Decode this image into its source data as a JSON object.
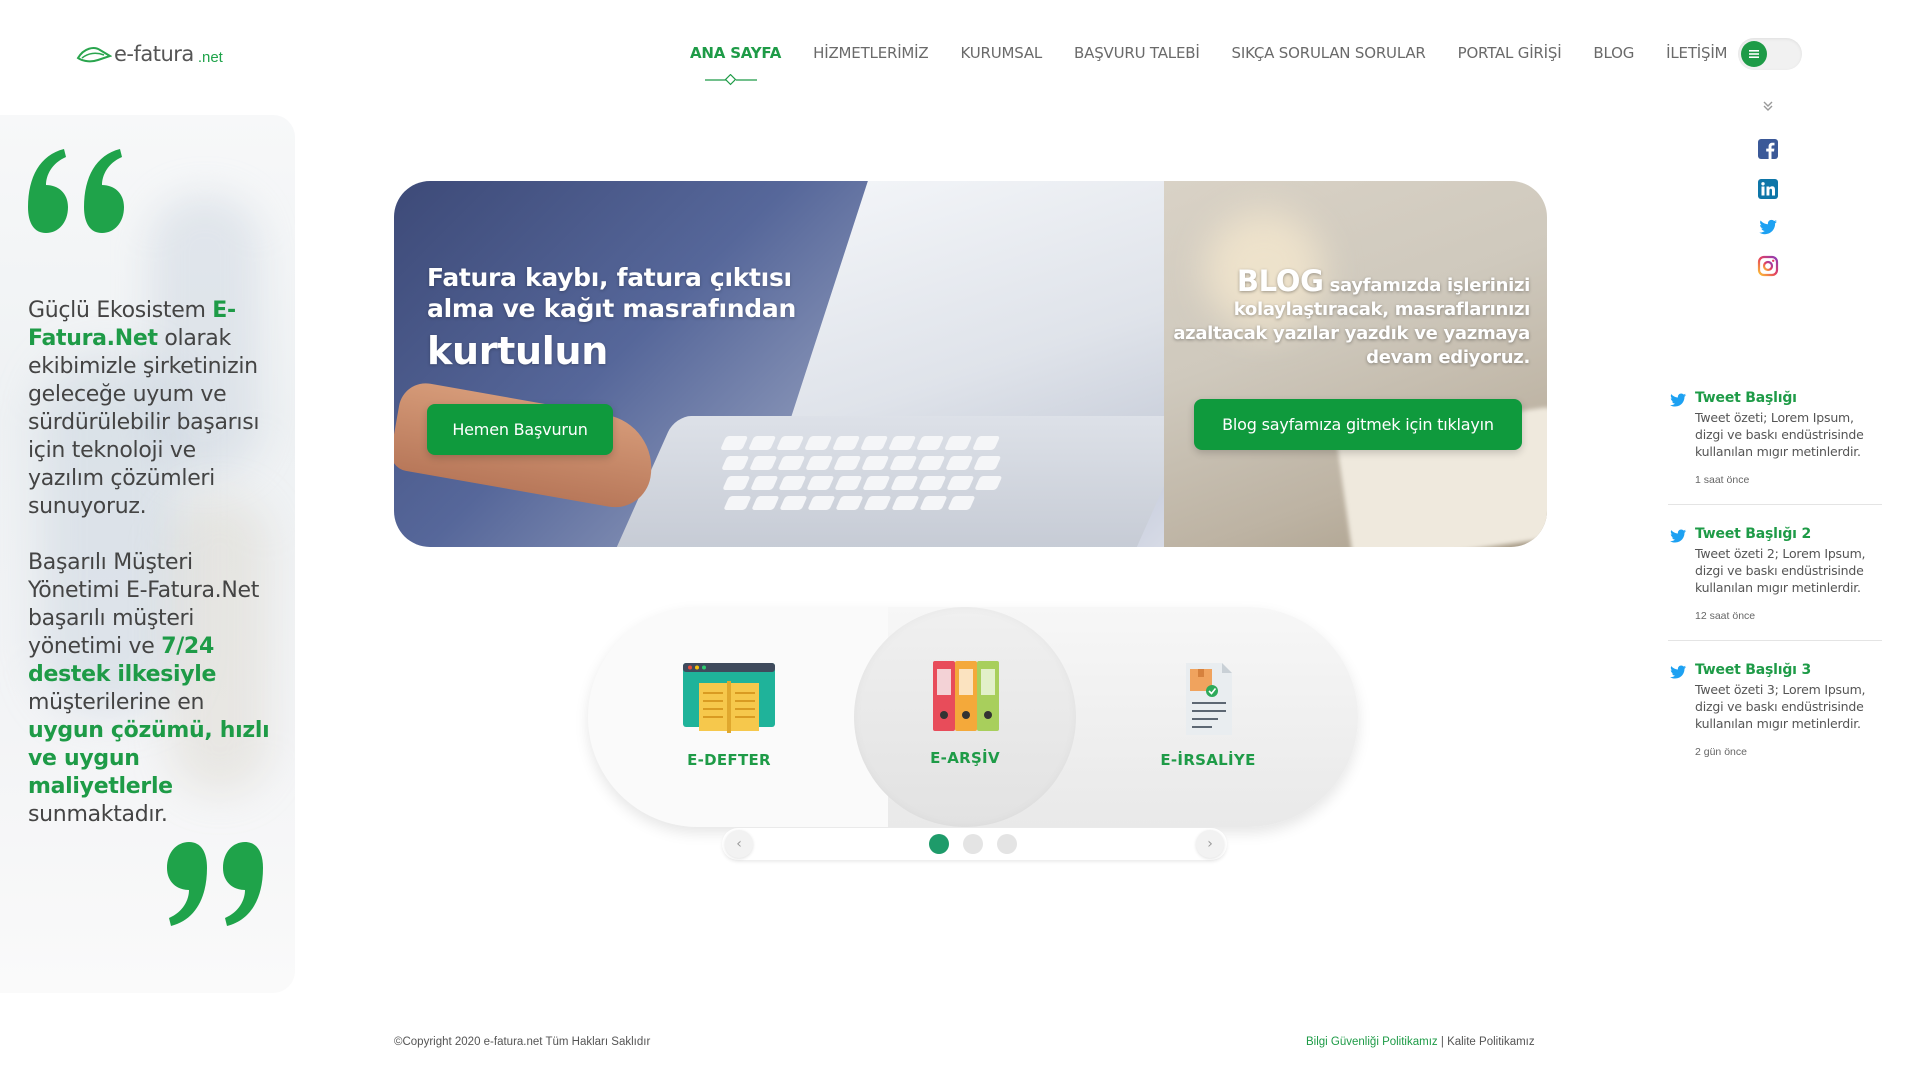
{
  "logo": {
    "text": "e-fatura",
    "tld": ".net"
  },
  "nav": [
    {
      "label": "ANA SAYFA",
      "active": true
    },
    {
      "label": "HİZMETLERİMİZ"
    },
    {
      "label": "KURUMSAL"
    },
    {
      "label": "BAŞVURU TALEBİ"
    },
    {
      "label": "SIKÇA SORULAN SORULAR"
    },
    {
      "label": "PORTAL GİRİŞİ"
    },
    {
      "label": "BLOG"
    },
    {
      "label": "İLETİŞİM"
    }
  ],
  "social": [
    "facebook-icon",
    "linkedin-icon",
    "twitter-icon",
    "instagram-icon"
  ],
  "quote": {
    "p1_a": "Güçlü Ekosistem ",
    "p1_brand": "E-Fatura.Net",
    "p1_b": " olarak ekibimizle şirketinizin geleceğe uyum ve sürdürülebilir başarısı için teknoloji ve yazılım çözümleri sunuyoruz.",
    "p2_a": "Başarılı Müşteri Yönetimi E-Fatura.Net başarılı müşteri yönetimi ve ",
    "p2_g1": "7/24 destek ilkesiyle",
    "p2_b": " müşterilerine en ",
    "p2_g2": "uygun çözümü, hızlı ve uygun maliyetlerle",
    "p2_c": " sunmaktadır."
  },
  "hero": {
    "title": "Fatura kaybı, fatura çıktısı alma ve kağıt masrafından",
    "title_big": "kurtulun",
    "apply_button": "Hemen Başvurun",
    "blog_word": "BLOG",
    "blog_text": " sayfamızda işlerinizi kolaylaştıracak, masraflarınızı azaltacak yazılar yazdık ve yazmaya devam ediyoruz.",
    "blog_button": "Blog sayfamıza gitmek için tıklayın"
  },
  "services": [
    {
      "label": "E-DEFTER",
      "icon": "book-icon"
    },
    {
      "label": "E-ARŞİV",
      "icon": "binders-icon"
    },
    {
      "label": "E-İRSALİYE",
      "icon": "document-icon"
    }
  ],
  "slider": {
    "prev": "‹",
    "next": "›",
    "dots": 3,
    "active_dot": 1
  },
  "tweets": [
    {
      "title": "Tweet Başlığı",
      "body": "Tweet özeti; Lorem Ipsum, dizgi ve baskı endüstrisinde kullanılan mıgır metinlerdir.",
      "time": "1 saat önce"
    },
    {
      "title": "Tweet Başlığı 2",
      "body": "Tweet özeti 2; Lorem Ipsum, dizgi ve baskı endüstrisinde kullanılan mıgır metinlerdir.",
      "time": "12 saat önce"
    },
    {
      "title": "Tweet Başlığı 3",
      "body": "Tweet özeti 3; Lorem Ipsum, dizgi ve baskı endüstrisinde kullanılan mıgır metinlerdir.",
      "time": "2 gün önce"
    }
  ],
  "footer": {
    "copyright": "©Copyright 2020 e-fatura.net Tüm Hakları Saklıdır",
    "link1": "Bilgi Güvenliği Politikamız",
    "separator": " | ",
    "link2": "Kalite Politikamız"
  },
  "colors": {
    "brand_green": "#1e9b47",
    "button_green": "#0f9a3d"
  }
}
